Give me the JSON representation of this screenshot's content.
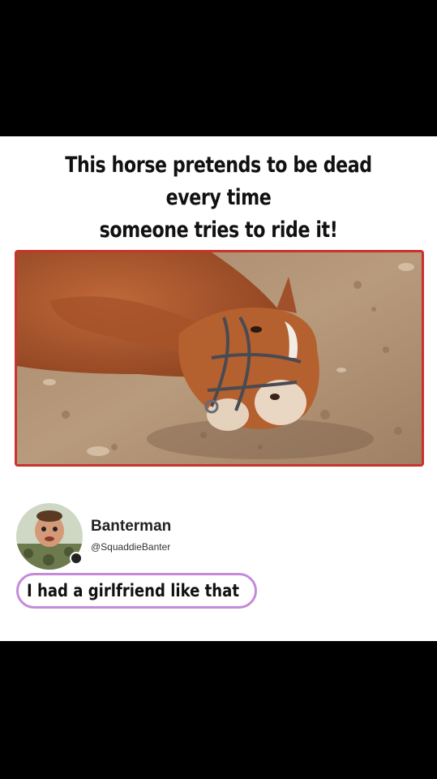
{
  "meme": {
    "headline_line1": "This horse pretends to be dead every time",
    "headline_line2": "someone tries to ride it!",
    "frame_color": "#c9332c"
  },
  "tweet": {
    "name": "Banterman",
    "handle": "@SquaddieBanter",
    "text": "I had a girlfriend like that",
    "highlight_color": "#c58ad9"
  }
}
